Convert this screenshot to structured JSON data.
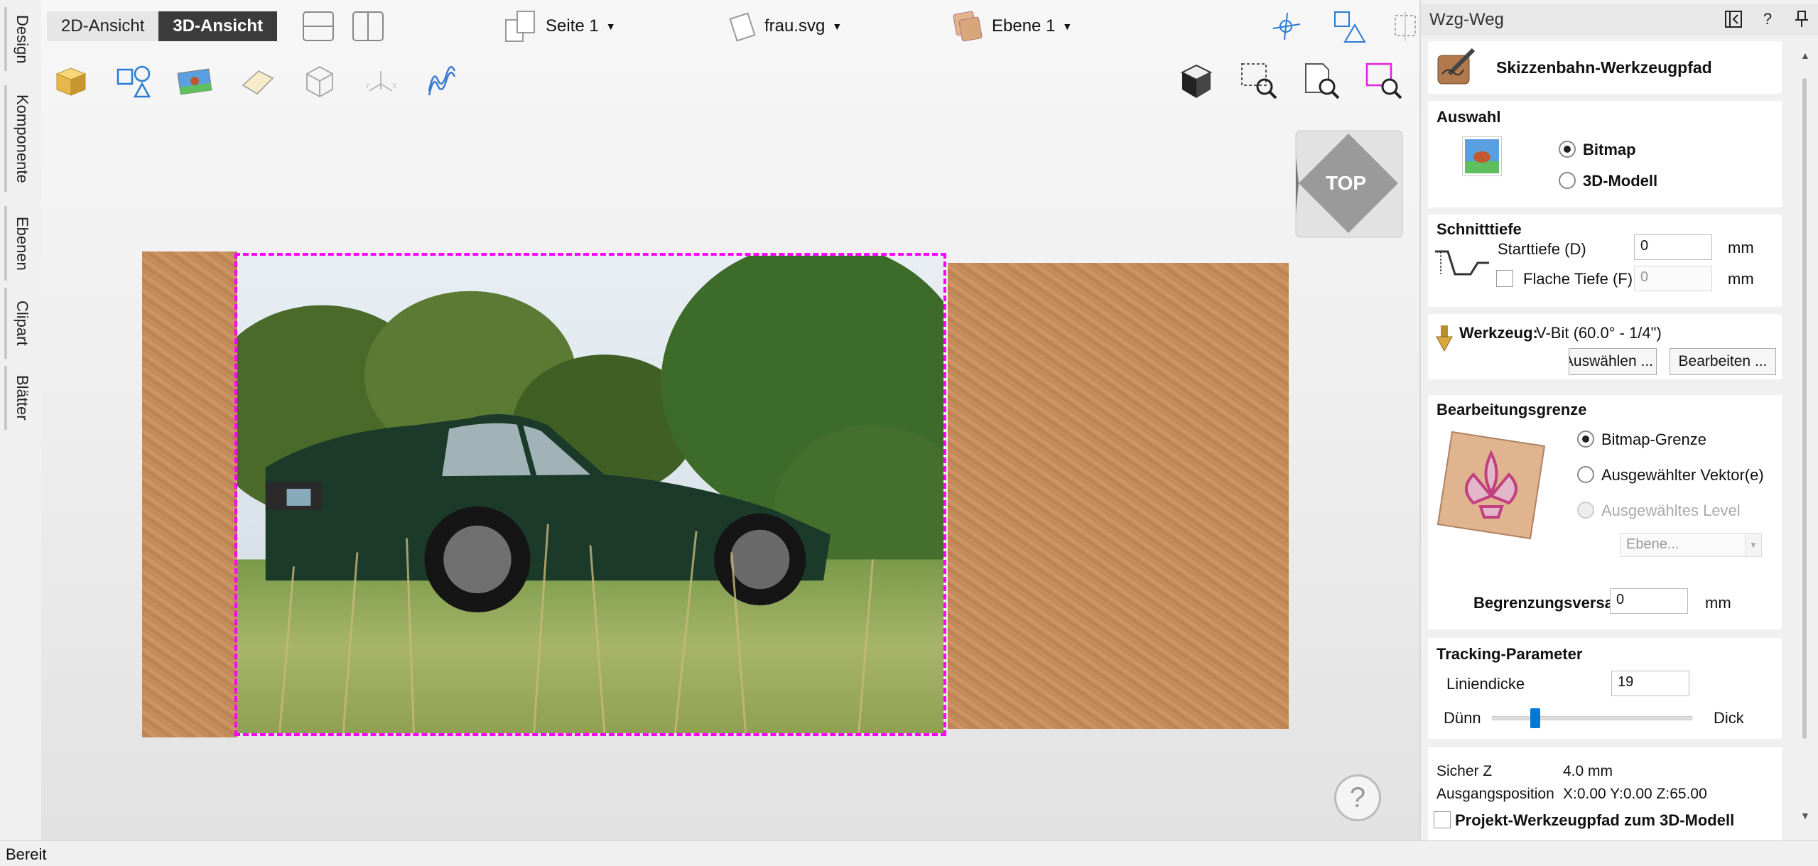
{
  "left_tabs": [
    {
      "label": "Design"
    },
    {
      "label": "Komponente"
    },
    {
      "label": "Ebenen"
    },
    {
      "label": "Clipart"
    },
    {
      "label": "Blätter"
    }
  ],
  "topbar": {
    "view_2d": "2D-Ansicht",
    "view_3d": "3D-Ansicht",
    "page_dropdown": "Seite 1",
    "file_dropdown": "frau.svg",
    "layer_dropdown": "Ebene 1"
  },
  "view_cube": {
    "label": "TOP"
  },
  "help": {
    "label": "?"
  },
  "panel": {
    "title": "Wzg-Weg",
    "header_title": "Skizzenbahn-Werkzeugpfad",
    "auswahl": {
      "title": "Auswahl",
      "option_bitmap": "Bitmap",
      "option_3d": "3D-Modell"
    },
    "schnitttiefe": {
      "title": "Schnitttiefe",
      "start_label": "Starttiefe (D)",
      "start_value": "0",
      "start_unit": "mm",
      "flat_label": "Flache Tiefe (F)",
      "flat_value": "0",
      "flat_unit": "mm"
    },
    "werkzeug": {
      "label": "Werkzeug:",
      "value": "V-Bit (60.0° - 1/4\")",
      "select_btn": "Auswählen ...",
      "edit_btn": "Bearbeiten ..."
    },
    "grenze": {
      "title": "Bearbeitungsgrenze",
      "opt_bitmap": "Bitmap-Grenze",
      "opt_vector": "Ausgewählter Vektor(e)",
      "opt_level": "Ausgewähltes Level",
      "level_select": "Ebene...",
      "offset_label": "Begrenzungsversatz",
      "offset_value": "0",
      "offset_unit": "mm"
    },
    "tracking": {
      "title": "Tracking-Parameter",
      "line_label": "Liniendicke",
      "line_value": "19",
      "thin": "Dünn",
      "thick": "Dick",
      "slider_fraction": 0.2
    },
    "bottom": {
      "safe_z_label": "Sicher Z",
      "safe_z_value": "4.0 mm",
      "home_label": "Ausgangsposition",
      "home_value": "X:0.00 Y:0.00 Z:65.00",
      "project_label": "Projekt-Werkzeugpfad zum 3D-Modell"
    }
  },
  "status": {
    "text": "Bereit"
  },
  "colors": {
    "accent": "#0078d7",
    "selection": "#ff00ff",
    "dark_button": "#3b3b3b"
  }
}
